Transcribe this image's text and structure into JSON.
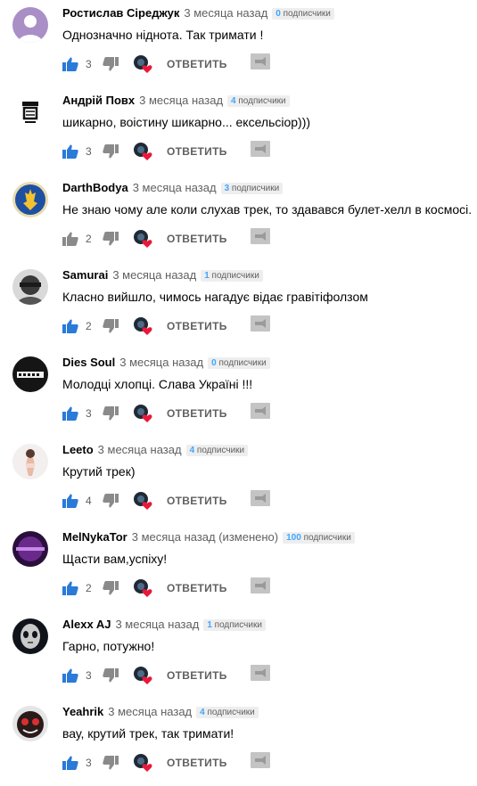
{
  "colors": {
    "accent": "#3ea6ff",
    "muted": "#606060",
    "heart": "#e8183a"
  },
  "icons": {
    "like": "thumb-up-icon",
    "dislike": "thumb-down-icon",
    "heart": "creator-heart-icon",
    "reply": "reply-icon"
  },
  "reply_label": "ОТВЕТИТЬ",
  "comments": [
    {
      "author": "Ростислав Сіреджук",
      "time": "3 месяца назад",
      "subs_num": "0",
      "subs_label": "подписчики",
      "text": "Однозначно ніднота. Так тримати !",
      "likes": "3"
    },
    {
      "author": "Андрій Повх",
      "time": "3 месяца назад",
      "subs_num": "4",
      "subs_label": "подписчики",
      "text": "шикарно, воістину шикарно... ексельсіор)))",
      "likes": "3"
    },
    {
      "author": "DarthBodya",
      "time": "3 месяца назад",
      "subs_num": "3",
      "subs_label": "подписчики",
      "text": "Не знаю чому але коли слухав трек, то здавався булет-хелл в космосі.",
      "likes": "2"
    },
    {
      "author": "Samurai",
      "time": "3 месяца назад",
      "subs_num": "1",
      "subs_label": "подписчики",
      "text": "Класно вийшло, чимось нагадує відає гравітіфолзом",
      "likes": "2"
    },
    {
      "author": "Dies Soul",
      "time": "3 месяца назад",
      "subs_num": "0",
      "subs_label": "подписчики",
      "text": "Молодці хлопці. Слава Україні !!!",
      "likes": "3"
    },
    {
      "author": "Leeto",
      "time": "3 месяца назад",
      "subs_num": "4",
      "subs_label": "подписчики",
      "text": "Крутий трек)",
      "likes": "4"
    },
    {
      "author": "MelNykaTor",
      "time": "3 месяца назад (изменено)",
      "subs_num": "100",
      "subs_label": "подписчики",
      "text": "Щасти вам,успіху!",
      "likes": "2"
    },
    {
      "author": "Alexx AJ",
      "time": "3 месяца назад",
      "subs_num": "1",
      "subs_label": "подписчики",
      "text": "Гарно, потужно!",
      "likes": "3"
    },
    {
      "author": "Yeahrik",
      "time": "3 месяца назад",
      "subs_num": "4",
      "subs_label": "подписчики",
      "text": "вау, крутий трек, так тримати!",
      "likes": "3"
    }
  ]
}
